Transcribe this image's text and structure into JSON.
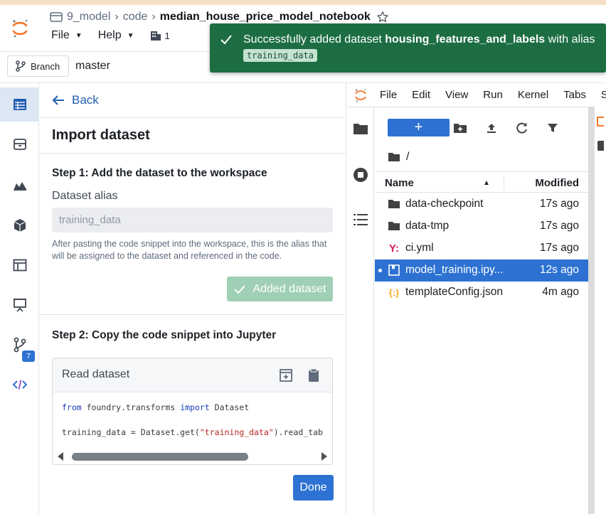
{
  "header": {
    "breadcrumb": [
      "9_model",
      "code",
      "median_house_price_model_notebook"
    ],
    "menus": [
      {
        "label": "File"
      },
      {
        "label": "Help"
      }
    ],
    "counter": "1"
  },
  "branch": {
    "button_label": "Branch",
    "name": "master"
  },
  "rail": {
    "badge": "7"
  },
  "panel": {
    "back_label": "Back",
    "title": "Import dataset",
    "step1": {
      "title": "Step 1: Add the dataset to the workspace",
      "alias_label": "Dataset alias",
      "alias_value": "training_data",
      "help": "After pasting the code snippet into the workspace, this is the alias that will be assigned to the dataset and referenced in the code.",
      "added_button": "Added dataset"
    },
    "step2": {
      "title": "Step 2: Copy the code snippet into Jupyter",
      "card_title": "Read dataset",
      "code_line1": {
        "kw1": "from",
        "mid": " foundry.transforms ",
        "kw2": "import",
        "end": " Dataset"
      },
      "code_line2": {
        "start": "training_data = Dataset.get(",
        "str": "\"training_data\"",
        "end": ").read_tab"
      }
    },
    "done_label": "Done"
  },
  "jupyter": {
    "menus": [
      "File",
      "Edit",
      "View",
      "Run",
      "Kernel",
      "Tabs",
      "S"
    ],
    "path": "/",
    "columns": {
      "name": "Name",
      "modified": "Modified"
    },
    "files": [
      {
        "name": "data-checkpoint",
        "modified": "17s ago",
        "icon": "folder-icon",
        "selected": false
      },
      {
        "name": "data-tmp",
        "modified": "17s ago",
        "icon": "folder-icon",
        "selected": false
      },
      {
        "name": "ci.yml",
        "modified": "17s ago",
        "icon": "yaml-icon",
        "selected": false
      },
      {
        "name": "model_training.ipy...",
        "modified": "12s ago",
        "icon": "notebook-icon",
        "selected": true
      },
      {
        "name": "templateConfig.json",
        "modified": "4m ago",
        "icon": "json-icon",
        "selected": false
      }
    ]
  },
  "toast": {
    "prefix": "Successfully added dataset ",
    "dataset": "housing_features_and_labels",
    "middle": " with alias",
    "alias": "training_data"
  },
  "colors": {
    "accent_blue": "#2d72d2",
    "success_green": "#1c6e42",
    "logo_orange": "#f37626"
  }
}
